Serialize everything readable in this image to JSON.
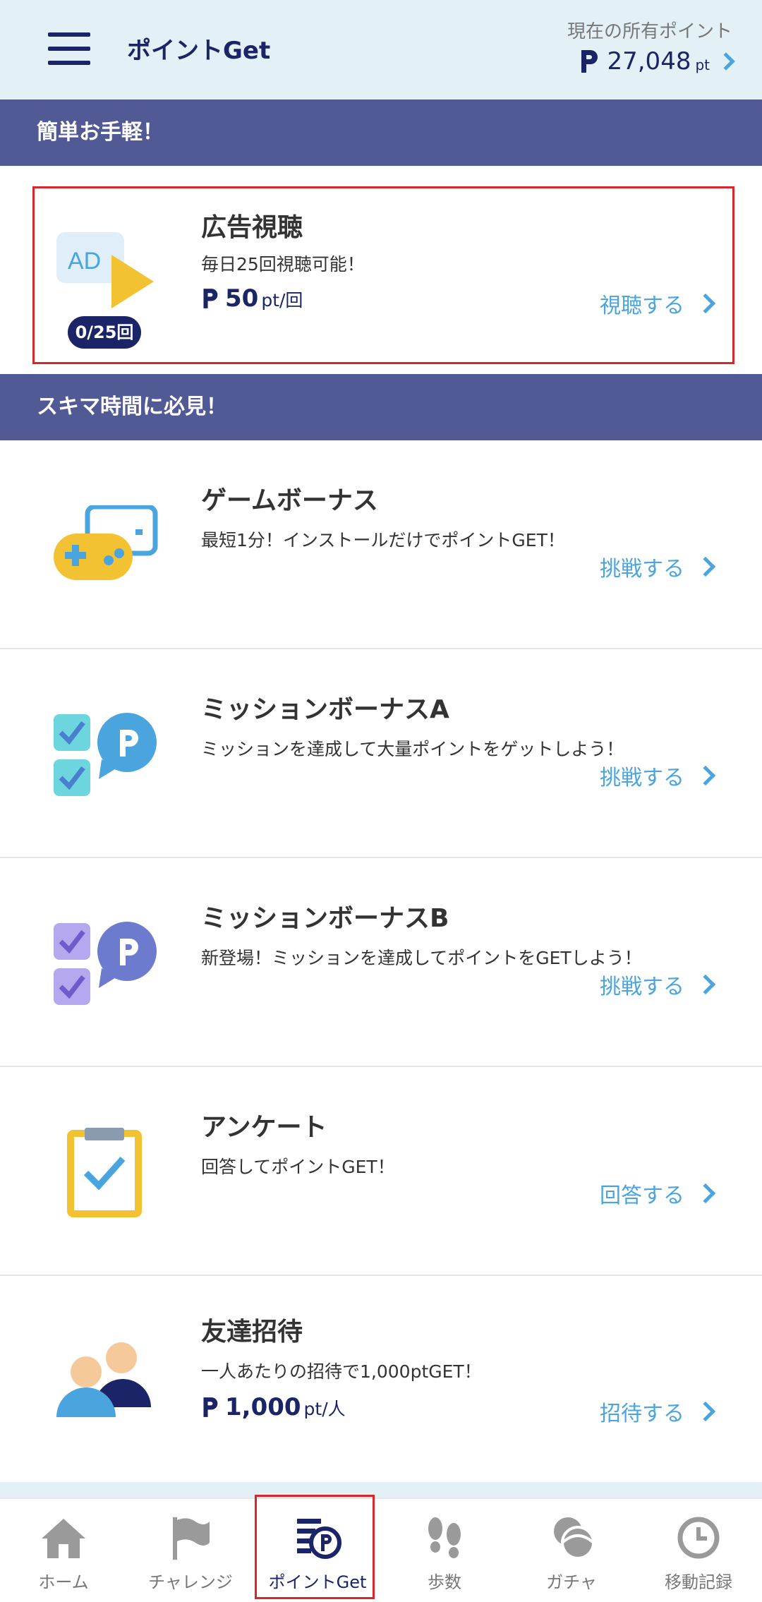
{
  "header": {
    "title": "ポイントGet",
    "points_label": "現在の所有ポイント",
    "points_value": "27,048",
    "points_unit": "pt"
  },
  "sections": {
    "easy": "簡単お手軽！",
    "spare": "スキマ時間に必見！"
  },
  "ad_card": {
    "icon_text": "AD",
    "counter": "0/25回",
    "title": "広告視聴",
    "desc": "毎日25回視聴可能！",
    "points_num": "50",
    "points_unit": "pt/回",
    "action": "視聴する"
  },
  "cards": [
    {
      "title": "ゲームボーナス",
      "desc": "最短1分！インストールだけでポイントGET！",
      "action": "挑戦する",
      "icon": "gamepad-icon"
    },
    {
      "title": "ミッションボーナスA",
      "desc": "ミッションを達成して大量ポイントをゲットしよう！",
      "action": "挑戦する",
      "icon": "mission-a-icon"
    },
    {
      "title": "ミッションボーナスB",
      "desc": "新登場！ミッションを達成してポイントをGETしよう！",
      "action": "挑戦する",
      "icon": "mission-b-icon"
    },
    {
      "title": "アンケート",
      "desc": "回答してポイントGET！",
      "action": "回答する",
      "icon": "clipboard-icon"
    },
    {
      "title": "友達招待",
      "desc": "一人あたりの招待で1,000ptGET！",
      "points_num": "1,000",
      "points_unit": "pt/人",
      "action": "招待する",
      "icon": "friends-icon"
    }
  ],
  "nav": [
    {
      "label": "ホーム",
      "icon": "home-icon"
    },
    {
      "label": "チャレンジ",
      "icon": "flag-icon"
    },
    {
      "label": "ポイントGet",
      "icon": "point-get-icon"
    },
    {
      "label": "歩数",
      "icon": "footsteps-icon"
    },
    {
      "label": "ガチャ",
      "icon": "gacha-icon"
    },
    {
      "label": "移動記録",
      "icon": "clock-icon"
    }
  ],
  "colors": {
    "navy": "#1a2466",
    "section_bar": "#525a96",
    "accent_blue": "#4aa4de",
    "header_bg": "#e3f1f7",
    "highlight_red": "#d8262c"
  }
}
